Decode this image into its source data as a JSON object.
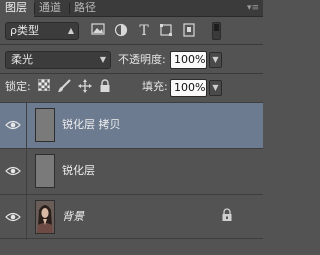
{
  "panel": {
    "tabs": [
      {
        "label": "图层",
        "active": true
      },
      {
        "label": "通道",
        "active": false
      },
      {
        "label": "路径",
        "active": false
      }
    ],
    "menu_icon": "panel-menu-icon"
  },
  "filter": {
    "kind_label": "ρ类型",
    "icons": [
      "image-filter-icon",
      "adjustment-filter-icon",
      "type-filter-icon",
      "shape-filter-icon",
      "smart-object-filter-icon",
      "filter-toggle-icon"
    ]
  },
  "blend": {
    "mode": "柔光",
    "opacity_label": "不透明度:",
    "opacity_value": "100%"
  },
  "lock": {
    "label": "锁定:",
    "icons": [
      "lock-transparent-pixels-icon",
      "lock-image-pixels-icon",
      "lock-position-icon",
      "lock-all-icon"
    ],
    "fill_label": "填充:",
    "fill_value": "100%"
  },
  "layers": [
    {
      "name": "锐化层 拷贝",
      "selected": true,
      "visible": true,
      "thumb": "gray",
      "locked": false
    },
    {
      "name": "锐化层",
      "selected": false,
      "visible": true,
      "thumb": "gray",
      "locked": false
    },
    {
      "name": "背景",
      "selected": false,
      "visible": true,
      "thumb": "photo",
      "locked": true
    }
  ],
  "colors": {
    "panel_bg": "#535353",
    "selected_row": "#6d7b90",
    "tab_bar": "#3b3b3b"
  }
}
